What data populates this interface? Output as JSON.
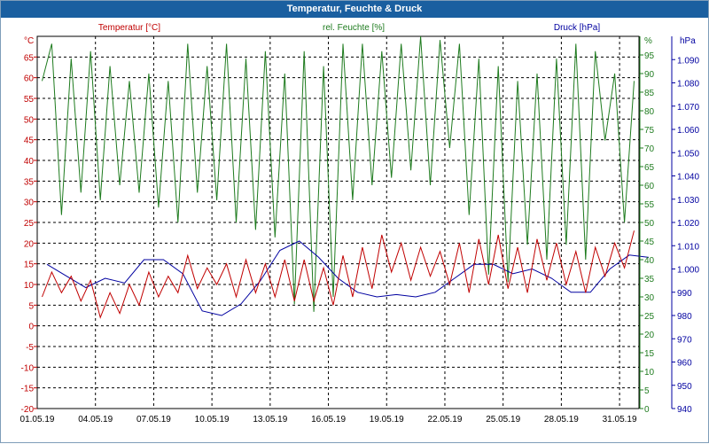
{
  "window": {
    "title": "Temperatur, Feuchte & Druck"
  },
  "chart_data": {
    "type": "line",
    "title": "Temperatur, Feuchte & Druck",
    "x_range": [
      "01.05.19",
      "01.06.19"
    ],
    "x_tick_labels": [
      "01.05.19",
      "04.05.19",
      "07.05.19",
      "10.05.19",
      "13.05.19",
      "16.05.19",
      "19.05.19",
      "22.05.19",
      "25.05.19",
      "28.05.19",
      "31.05.19"
    ],
    "grid": true,
    "axes": {
      "temperature": {
        "unit": "°C",
        "min": -20,
        "max": 70,
        "ticks": [
          -20,
          -15,
          -10,
          -5,
          0,
          5,
          10,
          15,
          20,
          25,
          30,
          35,
          40,
          45,
          50,
          55,
          60,
          65
        ],
        "color": "#c00000"
      },
      "humidity": {
        "unit": "%",
        "min": 0,
        "max": 100,
        "ticks": [
          0,
          5,
          10,
          15,
          20,
          25,
          30,
          35,
          40,
          45,
          50,
          55,
          60,
          65,
          70,
          75,
          80,
          85,
          90,
          95
        ],
        "color": "#1e7b1e"
      },
      "pressure": {
        "unit": "hPa",
        "min": 940,
        "max": 1100,
        "ticks": [
          940,
          950,
          960,
          970,
          980,
          990,
          1000,
          1010,
          1020,
          1030,
          1040,
          1050,
          1060,
          1070,
          1080,
          1090
        ],
        "tick_labels": [
          "940",
          "950",
          "960",
          "970",
          "980",
          "990",
          "1.000",
          "1.010",
          "1.020",
          "1.030",
          "1.040",
          "1.050",
          "1.060",
          "1.070",
          "1.080",
          "1.090"
        ],
        "color": "#0000a0"
      }
    },
    "series": [
      {
        "name": "Temperatur [°C]",
        "axis": "temperature",
        "color": "#c00000",
        "x": [
          "01.05.19",
          "01.05.19",
          "02.05.19",
          "02.05.19",
          "03.05.19",
          "03.05.19",
          "04.05.19",
          "04.05.19",
          "05.05.19",
          "05.05.19",
          "06.05.19",
          "06.05.19",
          "07.05.19",
          "07.05.19",
          "08.05.19",
          "08.05.19",
          "09.05.19",
          "09.05.19",
          "10.05.19",
          "10.05.19",
          "11.05.19",
          "11.05.19",
          "12.05.19",
          "12.05.19",
          "13.05.19",
          "13.05.19",
          "14.05.19",
          "14.05.19",
          "15.05.19",
          "15.05.19",
          "16.05.19",
          "16.05.19",
          "17.05.19",
          "17.05.19",
          "18.05.19",
          "18.05.19",
          "19.05.19",
          "19.05.19",
          "20.05.19",
          "20.05.19",
          "21.05.19",
          "21.05.19",
          "22.05.19",
          "22.05.19",
          "23.05.19",
          "23.05.19",
          "24.05.19",
          "24.05.19",
          "25.05.19",
          "25.05.19",
          "26.05.19",
          "26.05.19",
          "27.05.19",
          "27.05.19",
          "28.05.19",
          "28.05.19",
          "29.05.19",
          "29.05.19",
          "30.05.19",
          "30.05.19",
          "31.05.19",
          "31.05.19"
        ],
        "values": [
          7,
          13,
          8,
          12,
          6,
          11,
          2,
          8,
          3,
          10,
          5,
          13,
          7,
          12,
          8,
          17,
          9,
          14,
          10,
          15,
          7,
          16,
          8,
          15,
          7,
          16,
          6,
          16,
          6,
          14,
          5,
          17,
          7,
          19,
          9,
          22,
          13,
          20,
          11,
          19,
          12,
          18,
          10,
          20,
          8,
          21,
          10,
          22,
          9,
          19,
          8,
          21,
          11,
          20,
          10,
          18,
          8,
          19,
          12,
          20,
          14,
          23
        ]
      },
      {
        "name": "rel. Feuchte [%]",
        "axis": "humidity",
        "color": "#1e7b1e",
        "x": [
          "01.05.19",
          "01.05.19",
          "02.05.19",
          "02.05.19",
          "03.05.19",
          "03.05.19",
          "04.05.19",
          "04.05.19",
          "05.05.19",
          "05.05.19",
          "06.05.19",
          "06.05.19",
          "07.05.19",
          "07.05.19",
          "08.05.19",
          "08.05.19",
          "09.05.19",
          "09.05.19",
          "10.05.19",
          "10.05.19",
          "11.05.19",
          "11.05.19",
          "12.05.19",
          "12.05.19",
          "13.05.19",
          "13.05.19",
          "14.05.19",
          "14.05.19",
          "15.05.19",
          "15.05.19",
          "16.05.19",
          "16.05.19",
          "17.05.19",
          "17.05.19",
          "18.05.19",
          "18.05.19",
          "19.05.19",
          "19.05.19",
          "20.05.19",
          "20.05.19",
          "21.05.19",
          "21.05.19",
          "22.05.19",
          "22.05.19",
          "23.05.19",
          "23.05.19",
          "24.05.19",
          "24.05.19",
          "25.05.19",
          "25.05.19",
          "26.05.19",
          "26.05.19",
          "27.05.19",
          "27.05.19",
          "28.05.19",
          "28.05.19",
          "29.05.19",
          "29.05.19",
          "30.05.19",
          "30.05.19",
          "31.05.19",
          "31.05.19"
        ],
        "values": [
          88,
          98,
          52,
          94,
          58,
          96,
          56,
          92,
          60,
          88,
          58,
          90,
          54,
          88,
          50,
          98,
          58,
          92,
          56,
          98,
          50,
          94,
          48,
          96,
          46,
          90,
          28,
          96,
          26,
          92,
          30,
          98,
          56,
          98,
          60,
          96,
          62,
          98,
          64,
          100,
          60,
          99,
          70,
          98,
          52,
          94,
          36,
          92,
          34,
          88,
          44,
          90,
          40,
          94,
          44,
          98,
          40,
          96,
          72,
          90,
          50,
          88
        ]
      },
      {
        "name": "Druck [hPa]",
        "axis": "pressure",
        "color": "#0000a0",
        "x": [
          "01.05.19",
          "02.05.19",
          "03.05.19",
          "04.05.19",
          "05.05.19",
          "06.05.19",
          "07.05.19",
          "08.05.19",
          "09.05.19",
          "10.05.19",
          "11.05.19",
          "12.05.19",
          "13.05.19",
          "14.05.19",
          "15.05.19",
          "16.05.19",
          "17.05.19",
          "18.05.19",
          "19.05.19",
          "20.05.19",
          "21.05.19",
          "22.05.19",
          "23.05.19",
          "24.05.19",
          "25.05.19",
          "26.05.19",
          "27.05.19",
          "28.05.19",
          "29.05.19",
          "30.05.19",
          "31.05.19",
          "01.06.19"
        ],
        "values": [
          1002,
          997,
          992,
          996,
          994,
          1004,
          1004,
          998,
          982,
          980,
          985,
          995,
          1008,
          1012,
          1005,
          996,
          990,
          988,
          989,
          988,
          990,
          996,
          1002,
          1002,
          998,
          1000,
          996,
          990,
          990,
          1000,
          1006,
          1005
        ]
      }
    ]
  }
}
